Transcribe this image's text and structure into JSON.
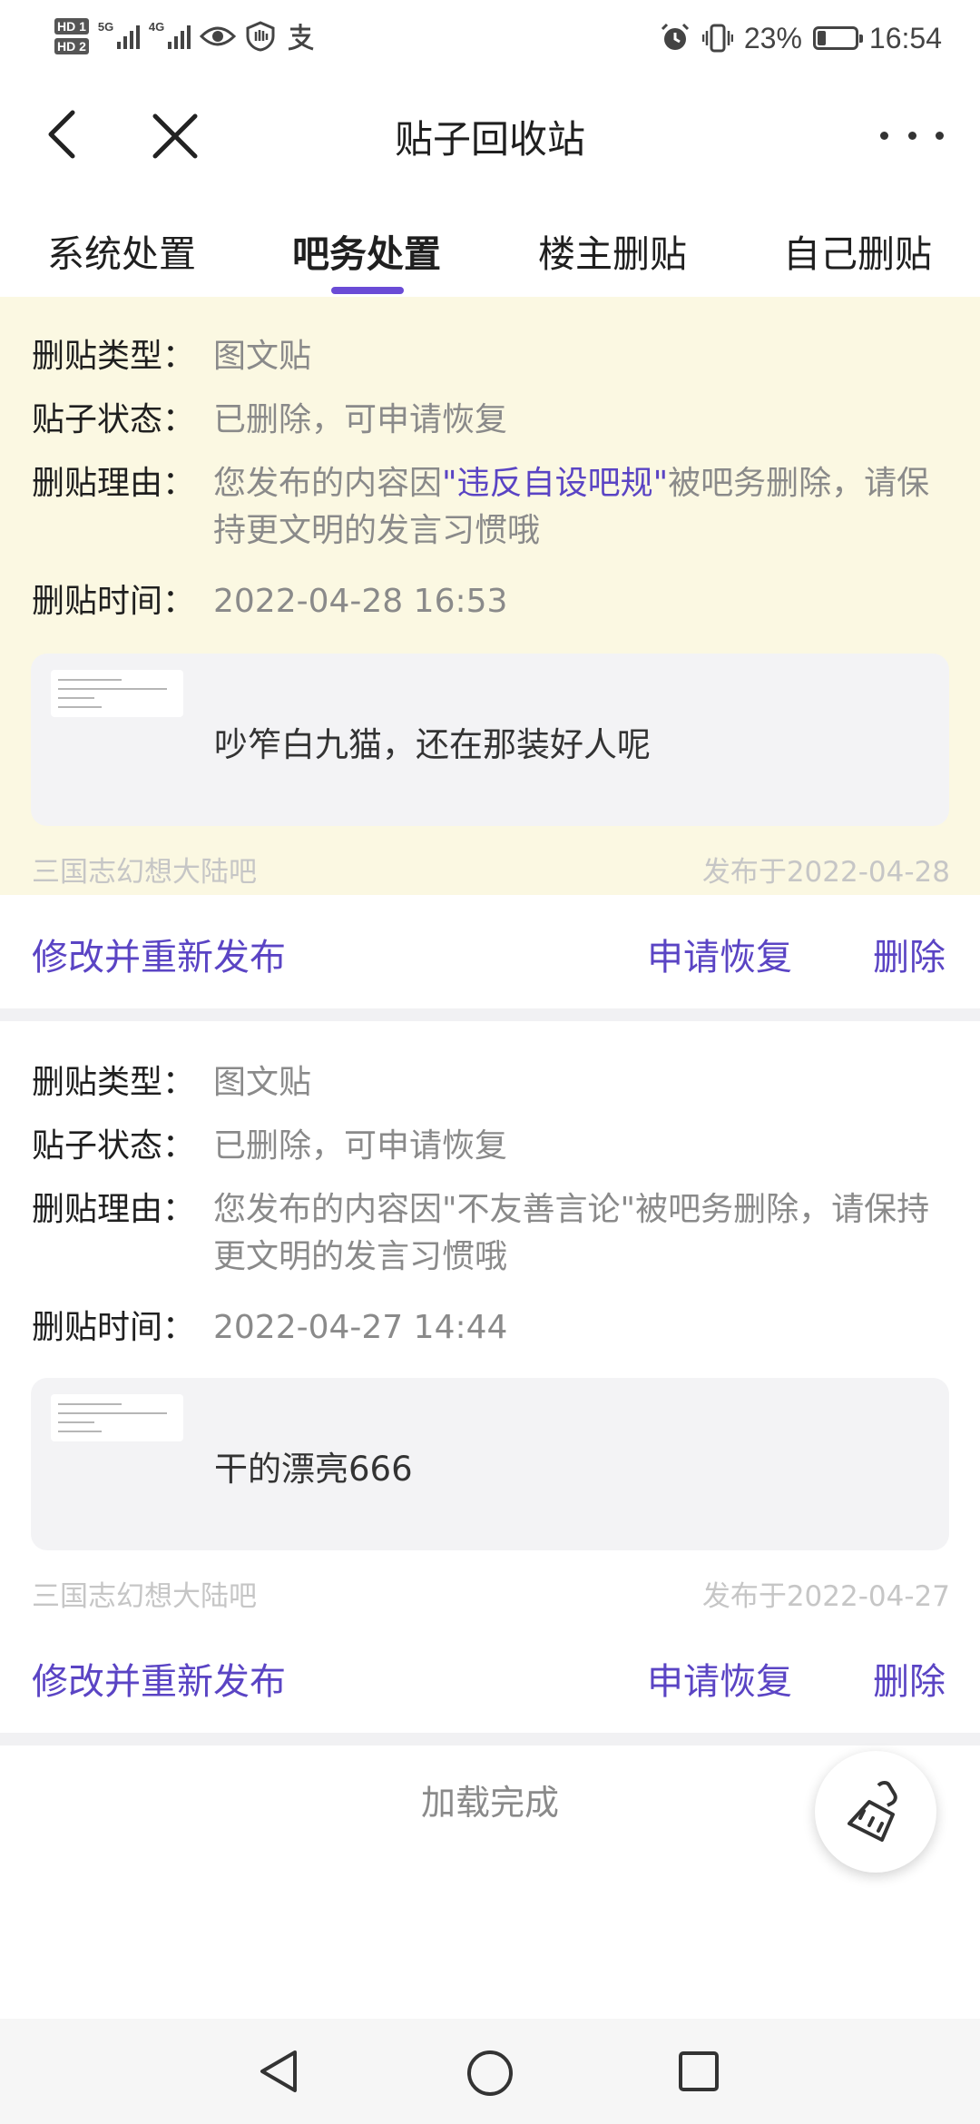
{
  "status_bar": {
    "sim1": "HD 1",
    "sim2": "HD 2",
    "net1": "5G",
    "net2": "4G",
    "battery": "23%",
    "battery_level": 0.23,
    "time": "16:54",
    "icons": [
      "eye-icon",
      "shield-icon",
      "alipay-icon",
      "alarm-icon",
      "vibrate-icon",
      "battery-icon"
    ]
  },
  "header": {
    "title": "贴子回收站"
  },
  "tabs": [
    {
      "label": "系统处置"
    },
    {
      "label": "吧务处置"
    },
    {
      "label": "楼主删贴"
    },
    {
      "label": "自己删贴"
    }
  ],
  "active_tab": "吧务处置",
  "accent_color": "#5a44c4",
  "posts": [
    {
      "type_label": "删贴类型：",
      "type_value": "图文贴",
      "status_label": "贴子状态：",
      "status_value": "已删除，可申请恢复",
      "reason_label": "删贴理由：",
      "reason_prefix": "您发布的内容因",
      "reason_rule": "\"违反自设吧规\"",
      "reason_suffix": "被吧务删除，请保持更文明的发言习惯哦",
      "time_label": "删贴时间：",
      "time_value": "2022-04-28 16:53",
      "content": "吵笮白九猫，还在那装好人呢",
      "forum": "三国志幻想大陆吧",
      "published": "发布于2022-04-28",
      "actions": {
        "edit": "修改并重新发布",
        "restore": "申请恢复",
        "delete": "删除"
      }
    },
    {
      "type_label": "删贴类型：",
      "type_value": "图文贴",
      "status_label": "贴子状态：",
      "status_value": "已删除，可申请恢复",
      "reason_label": "删贴理由：",
      "reason_text": "您发布的内容因\"不友善言论\"被吧务删除，请保持更文明的发言习惯哦",
      "time_label": "删贴时间：",
      "time_value": "2022-04-27 14:44",
      "content": "干的漂亮666",
      "forum": "三国志幻想大陆吧",
      "published": "发布于2022-04-27",
      "actions": {
        "edit": "修改并重新发布",
        "restore": "申请恢复",
        "delete": "删除"
      }
    }
  ],
  "footer": {
    "loaded_text": "加载完成"
  }
}
